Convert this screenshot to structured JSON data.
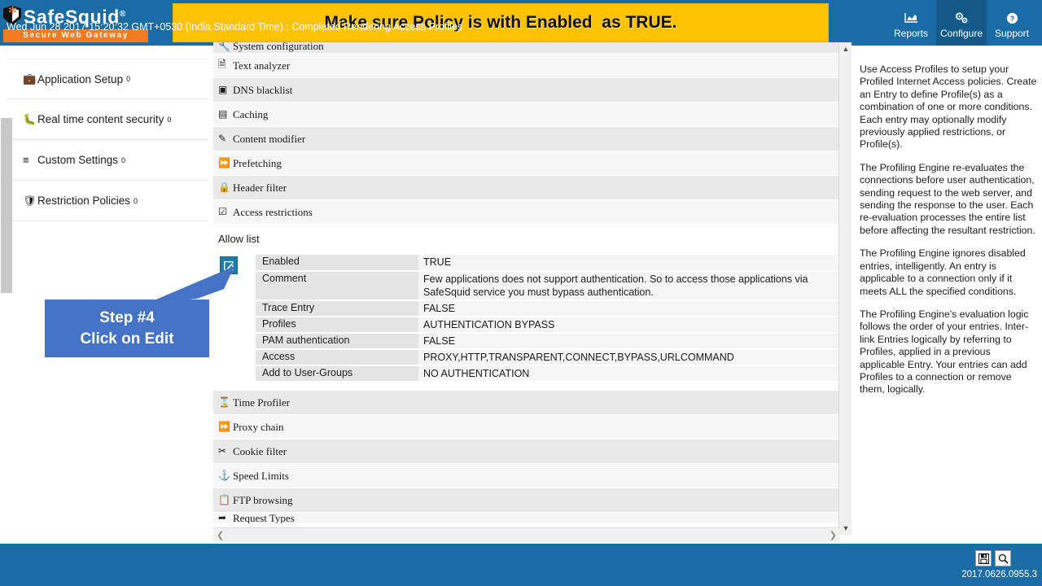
{
  "header": {
    "logo_name": "SafeSquid",
    "logo_trademark": "®",
    "logo_tagline": "Secure Web Gateway",
    "banner_text": "Make sure Policy is with Enabled  as TRUE.",
    "nav": [
      {
        "label": "Reports",
        "icon": "chart-icon",
        "active": false
      },
      {
        "label": "Configure",
        "icon": "gears-icon",
        "active": true
      },
      {
        "label": "Support",
        "icon": "help-circle-icon",
        "active": false
      }
    ]
  },
  "sidebar": {
    "items": [
      {
        "label": "Application Setup",
        "badge": "0",
        "icon": "briefcase-icon"
      },
      {
        "label": "Real time content security",
        "badge": "0",
        "icon": "bug-icon"
      },
      {
        "label": "Custom Settings",
        "badge": "0",
        "icon": "sliders-icon"
      },
      {
        "label": "Restriction Policies",
        "badge": "0",
        "icon": "shield-icon"
      }
    ]
  },
  "main": {
    "rows_top": [
      {
        "label": "System configuration",
        "icon": "wrench-icon",
        "clipped": true
      },
      {
        "label": "Text analyzer",
        "icon": "document-icon",
        "clipped": false
      },
      {
        "label": "DNS blacklist",
        "icon": "dns-icon",
        "clipped": false
      },
      {
        "label": "Caching",
        "icon": "database-icon",
        "clipped": false
      },
      {
        "label": "Content modifier",
        "icon": "pencil-square-icon",
        "clipped": false
      },
      {
        "label": "Prefetching",
        "icon": "forward-icon",
        "clipped": false
      },
      {
        "label": "Header filter",
        "icon": "lock-icon",
        "clipped": false
      },
      {
        "label": "Access restrictions",
        "icon": "checkbox-icon",
        "clipped": false
      }
    ],
    "allow_list": {
      "title": "Allow list",
      "edit_icon": "edit-pencil-icon",
      "fields": [
        {
          "key": "Enabled",
          "value": "TRUE"
        },
        {
          "key": "Comment",
          "value": "Few applications does not support authentication. So to access those applications via SafeSquid service you must bypass authentication."
        },
        {
          "key": "Trace Entry",
          "value": "FALSE"
        },
        {
          "key": "Profiles",
          "value": "AUTHENTICATION BYPASS"
        },
        {
          "key": "PAM authentication",
          "value": "FALSE"
        },
        {
          "key": "Access",
          "value": "PROXY,HTTP,TRANSPARENT,CONNECT,BYPASS,URLCOMMAND"
        },
        {
          "key": "Add to User-Groups",
          "value": "NO AUTHENTICATION"
        }
      ]
    },
    "rows_bottom": [
      {
        "label": "Time Profiler",
        "icon": "hourglass-icon",
        "clipped": false
      },
      {
        "label": "Proxy chain",
        "icon": "fast-forward-icon",
        "clipped": false
      },
      {
        "label": "Cookie filter",
        "icon": "scissors-icon",
        "clipped": false
      },
      {
        "label": "Speed Limits",
        "icon": "gauge-icon",
        "clipped": false
      },
      {
        "label": "FTP browsing",
        "icon": "copy-icon",
        "clipped": false
      },
      {
        "label": "Request Types",
        "icon": "arrow-icon",
        "clipped": true
      }
    ]
  },
  "help": {
    "paragraphs": [
      "Use Access Profiles to setup your Profiled Internet Access policies. Create an Entry to define Profile(s) as a combination of one or more conditions. Each entry may optionally modify previously applied restrictions, or Profile(s).",
      "The Profiling Engine re-evaluates the connections before user authentication, sending request to the web server, and sending the response to the user. Each re-evaluation processes the entire list before affecting the resultant restriction.",
      "The Profiling Engine ignores disabled entries, intelligently. An entry is applicable to a connection only if it meets ALL the specified conditions.",
      "The Profiling Engine's evaluation logic follows the order of your entries. Inter-link Entries logically by referring to Profiles, applied in a previous applicable Entry. Your entries can add Profiles to a connection or remove them, logically."
    ]
  },
  "callout": {
    "line1": "Step #4",
    "line2": "Click on Edit"
  },
  "statusbar": {
    "message": "Wed Jun 28 2017 15:20:32 GMT+0530 (India Standard Time) : Completed Rendering Access Profiles",
    "version": "2017.0626.0955.3",
    "save_icon": "save-floppy-icon",
    "search_icon": "search-icon"
  },
  "scrollbars": {
    "up_arrow": "▲",
    "down_arrow": "▼",
    "left_arrow": "❮",
    "right_arrow": "❯"
  },
  "colors": {
    "brand_blue": "#1a6ca4",
    "banner_yellow": "#fdc300",
    "accent_orange": "#f47b20",
    "callout_blue": "#4472c4",
    "edit_btn": "#1f7ca8"
  }
}
